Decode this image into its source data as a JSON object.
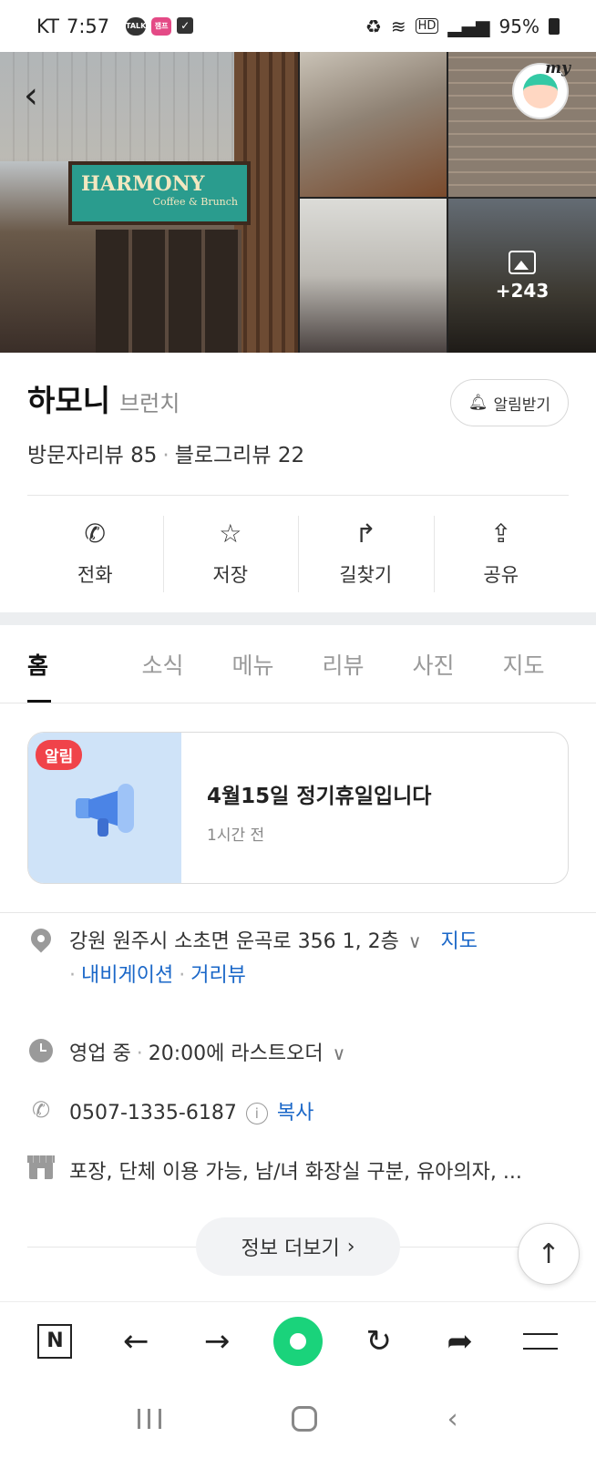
{
  "status_bar": {
    "carrier": "KT",
    "time": "7:57",
    "icons": [
      "talk-icon",
      "pink-app-icon",
      "check-icon"
    ],
    "talk_label": "TALK",
    "pink_label": "잼프",
    "hd_label": "HD",
    "battery": "95%"
  },
  "photos": {
    "sign_title": "HARMONY",
    "sign_sub": "Coffee & Brunch",
    "more_count": "+243",
    "my_label": "my"
  },
  "place": {
    "name": "하모니",
    "category": "브런치",
    "alarm_label": "알림받기",
    "visitor_reviews": "방문자리뷰 85",
    "blog_reviews": "블로그리뷰 22"
  },
  "actions": [
    {
      "label": "전화",
      "icon": "phone-icon"
    },
    {
      "label": "저장",
      "icon": "star-icon"
    },
    {
      "label": "길찾기",
      "icon": "directions-icon"
    },
    {
      "label": "공유",
      "icon": "share-icon"
    }
  ],
  "tabs": [
    "홈",
    "소식",
    "메뉴",
    "리뷰",
    "사진",
    "지도"
  ],
  "notice": {
    "badge": "알림",
    "title": "4월15일 정기휴일입니다",
    "time": "1시간 전"
  },
  "info": {
    "address": "강원 원주시 소초면 운곡로 356 1, 2층",
    "map_link": "지도",
    "navigation_link": "내비게이션",
    "street_view_link": "거리뷰",
    "hours_status": "영업 중",
    "last_order": "20:00에 라스트오더",
    "phone": "0507-1335-6187",
    "copy_label": "복사",
    "amenities": "포장, 단체 이용 가능, 남/녀 화장실 구분, 유아의자, ..."
  },
  "more_info_label": "정보 더보기",
  "colors": {
    "link": "#1a67c8",
    "naver_green": "#1ad37b",
    "badge_red": "#f0434a"
  }
}
